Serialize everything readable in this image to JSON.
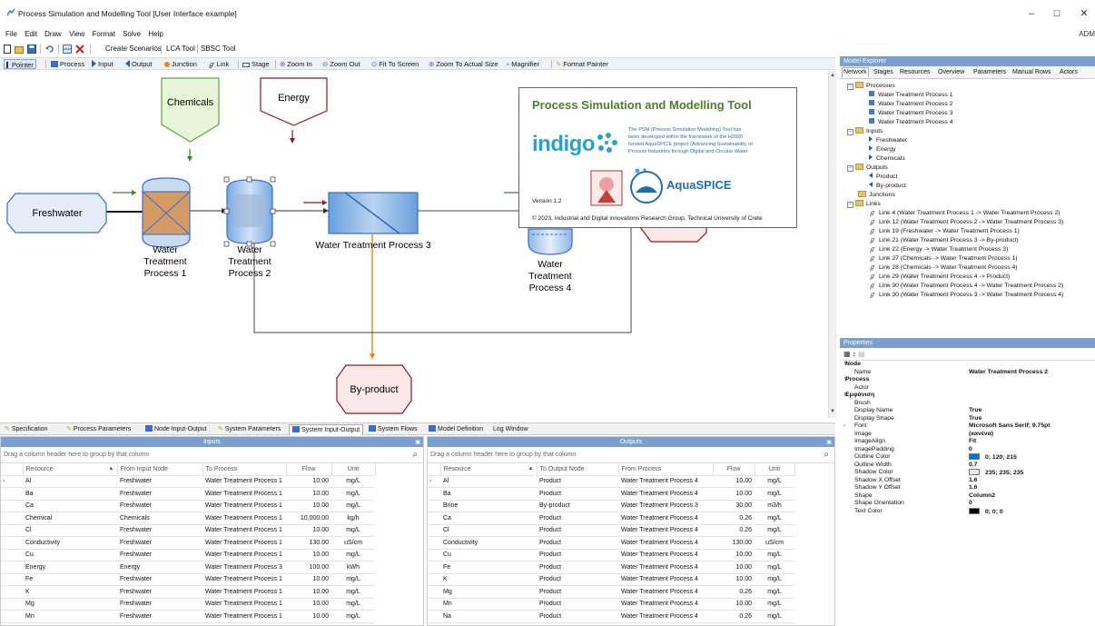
{
  "window": {
    "title": "Process Simulation and Modelling Tool [User Interface example]",
    "user": "ADM"
  },
  "menu": [
    "File",
    "Edit",
    "Draw",
    "View",
    "Format",
    "Solve",
    "Help"
  ],
  "toolbar": {
    "create_scenarios": "Create Scenarios",
    "lca": "LCA Tool",
    "sbsc": "SBSC Tool"
  },
  "drawbar": {
    "pointer": "Pointer",
    "process": "Process",
    "input": "Input",
    "output": "Output",
    "junction": "Junction",
    "link": "Link",
    "stage": "Stage",
    "zoom_in": "Zoom In",
    "zoom_out": "Zoom Out",
    "fit": "Fit To Screen",
    "actual": "Zoom To Actual Size",
    "magnifier": "Magnifier",
    "format_painter": "Format Painter"
  },
  "diagram": {
    "chemicals": "Chemicals",
    "energy": "Energy",
    "freshwater": "Freshwater",
    "wtp1": [
      "Water",
      "Treatment",
      "Process 1"
    ],
    "wtp2": [
      "Water",
      "Treatment",
      "Process 2"
    ],
    "wtp3": "Water Treatment Process 3",
    "wtp4": [
      "Water",
      "Treatment",
      "Process 4"
    ],
    "byproduct": "By-product"
  },
  "splash": {
    "title": "Process Simulation and Modelling Tool",
    "logo": "indigo",
    "text": [
      "The PSM (Process Simulation Modelling) Tool has",
      "been developed within the framework of the H2020",
      "funded AquaSPICE  project (Advancing Sustainability of",
      "Process Industries through Digital and Circular  Water"
    ],
    "aquaspice": "AquaSPICE",
    "version": "Version 1.2",
    "copyright": "© 2023, Industrial and Digital innovations Research Group, Technical University of Crete"
  },
  "bottom_tabs": [
    "Specification",
    "Process Parameters",
    "Node Input-Output",
    "System Parameters",
    "System Input-Output",
    "System Flows",
    "Model Definition",
    "Log Window"
  ],
  "inputs": {
    "header": "Inputs",
    "group_hint": "Drag a column header here to group by that column",
    "columns": [
      "Resource",
      "From Input Node",
      "To Process",
      "Flow",
      "Unit"
    ],
    "rows": [
      [
        "Al",
        "Freshwater",
        "Water Treatment Process 1",
        "10.00",
        "mg/L"
      ],
      [
        "Ba",
        "Freshwater",
        "Water Treatment Process 1",
        "10.00",
        "mg/L"
      ],
      [
        "Ca",
        "Freshwater",
        "Water Treatment Process 1",
        "10.00",
        "mg/L"
      ],
      [
        "Chemical",
        "Chemicals",
        "Water Treatment Process 1",
        "10,000.00",
        "kg/h"
      ],
      [
        "Cl",
        "Freshwater",
        "Water Treatment Process 1",
        "10.00",
        "mg/L"
      ],
      [
        "Conductivity",
        "Freshwater",
        "Water Treatment Process 1",
        "130.00",
        "uS/cm"
      ],
      [
        "Cu",
        "Freshwater",
        "Water Treatment Process 1",
        "10.00",
        "mg/L"
      ],
      [
        "Energy",
        "Energy",
        "Water Treatment Process 3",
        "100.00",
        "kWh"
      ],
      [
        "Fe",
        "Freshwater",
        "Water Treatment Process 1",
        "10.00",
        "mg/L"
      ],
      [
        "K",
        "Freshwater",
        "Water Treatment Process 1",
        "10.00",
        "mg/L"
      ],
      [
        "Mg",
        "Freshwater",
        "Water Treatment Process 1",
        "10.00",
        "mg/L"
      ],
      [
        "Mn",
        "Freshwater",
        "Water Treatment Process 1",
        "10.00",
        "mg/L"
      ]
    ]
  },
  "outputs": {
    "header": "Outputs",
    "group_hint": "Drag a column header here to group by that column",
    "columns": [
      "Resource",
      "To Output Node",
      "From Process",
      "Flow",
      "Unit"
    ],
    "rows": [
      [
        "Al",
        "Product",
        "Water Treatment Process 4",
        "10.00",
        "mg/L"
      ],
      [
        "Ba",
        "Product",
        "Water Treatment Process 4",
        "10.00",
        "mg/L"
      ],
      [
        "Brine",
        "By-product",
        "Water Treatment Process 3",
        "30.00",
        "m3/h"
      ],
      [
        "Ca",
        "Product",
        "Water Treatment Process 4",
        "0.26",
        "mg/L"
      ],
      [
        "Cl",
        "Product",
        "Water Treatment Process 4",
        "0.26",
        "mg/L"
      ],
      [
        "Conductivity",
        "Product",
        "Water Treatment Process 4",
        "130.00",
        "uS/cm"
      ],
      [
        "Cu",
        "Product",
        "Water Treatment Process 4",
        "10.00",
        "mg/L"
      ],
      [
        "Fe",
        "Product",
        "Water Treatment Process 4",
        "10.00",
        "mg/L"
      ],
      [
        "K",
        "Product",
        "Water Treatment Process 4",
        "10.00",
        "mg/L"
      ],
      [
        "Mg",
        "Product",
        "Water Treatment Process 4",
        "0.26",
        "mg/L"
      ],
      [
        "Mn",
        "Product",
        "Water Treatment Process 4",
        "10.00",
        "mg/L"
      ],
      [
        "Na",
        "Product",
        "Water Treatment Process 4",
        "0.26",
        "mg/L"
      ]
    ]
  },
  "explorer": {
    "title": "Model Explorer",
    "tabs": [
      "Network",
      "Stages",
      "Resources",
      "Overview",
      "Parameters",
      "Manual Rows",
      "Actors"
    ],
    "processes_label": "Processes",
    "processes": [
      "Water Treatment Process 1",
      "Water Treatment Process 2",
      "Water Treatment Process 3",
      "Water Treatment Process 4"
    ],
    "inputs_label": "Inputs",
    "inputs": [
      "Freshwater",
      "Energy",
      "Chemicals"
    ],
    "outputs_label": "Outputs",
    "outputs": [
      "Product",
      "By-product"
    ],
    "junctions_label": "Junctions",
    "links_label": "Links",
    "links": [
      "Link 4 (Water Treatment Process 1 -> Water Treatment Process 2)",
      "Link 12 (Water Treatment Process 2 -> Water Treatment Process 3)",
      "Link 19 (Freshwater -> Water Treatment Process 1)",
      "Link 21 (Water Treatment Process 3 -> By-product)",
      "Link 22 (Energy -> Water Treatment Process 3)",
      "Link 27 (Chemicals -> Water Treatment Process 1)",
      "Link 28 (Chemicals -> Water Treatment Process 4)",
      "Link 29 (Water Treatment Process 4 -> Product)",
      "Link 30 (Water Treatment Process 4 -> Water Treatment Process 2)",
      "Link 30 (Water Treatment Process 3 -> Water Treatment Process 4)"
    ]
  },
  "properties": {
    "title": "Properties",
    "rows": [
      {
        "cat": true,
        "k": "Node"
      },
      {
        "k": "Name",
        "v": "Water Treatment Process 2"
      },
      {
        "cat": true,
        "k": "Process"
      },
      {
        "k": "Actor",
        "v": ""
      },
      {
        "cat": true,
        "k": "Εμφάνιση"
      },
      {
        "k": "Brush",
        "v": ""
      },
      {
        "k": "Display Name",
        "v": "True"
      },
      {
        "k": "Display Shape",
        "v": "True"
      },
      {
        "k": "Font",
        "v": "Microsoft Sans Serif; 9.75pt",
        "exp": true
      },
      {
        "k": "Image",
        "v": "(κανένα)"
      },
      {
        "k": "ImageAlign",
        "v": "Fit"
      },
      {
        "k": "ImagePadding",
        "v": "0"
      },
      {
        "k": "Outline Color",
        "v": "0; 120; 215",
        "sw": "#0078d7"
      },
      {
        "k": "Outline Width",
        "v": "0.7"
      },
      {
        "k": "Shadow Color",
        "v": "235; 235; 235",
        "sw": "#ebebeb"
      },
      {
        "k": "Shadow X Offset",
        "v": "1.6"
      },
      {
        "k": "Shadow Y Offset",
        "v": "1.6"
      },
      {
        "k": "Shape",
        "v": "Column2"
      },
      {
        "k": "Shape Orientation",
        "v": "0"
      },
      {
        "k": "Text Color",
        "v": "0; 0; 0",
        "sw": "#000000"
      }
    ]
  }
}
